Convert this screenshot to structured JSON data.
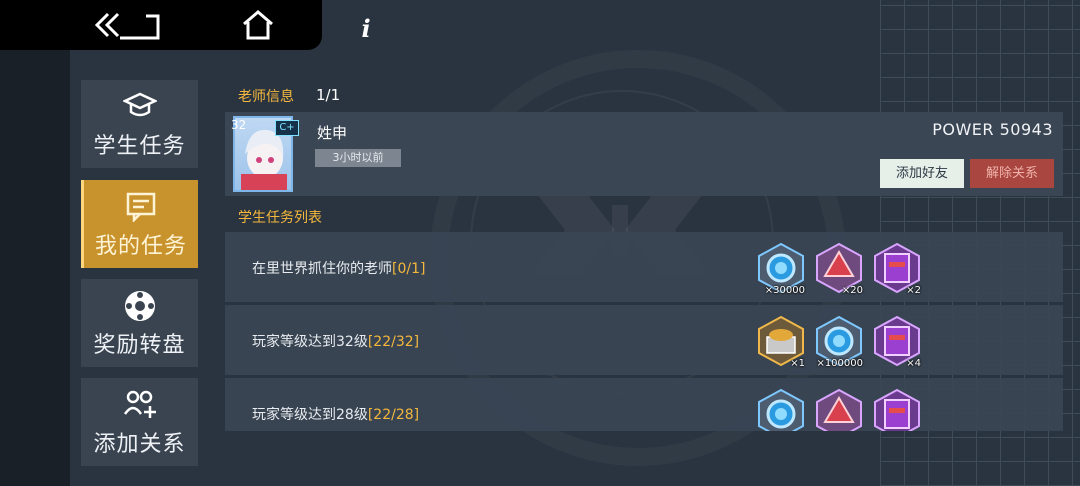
{
  "nav": {
    "back_icon": "double-chevron-left-icon",
    "home_icon": "home-icon",
    "info_label": "i"
  },
  "sidebar": {
    "items": [
      {
        "label": "学生任务",
        "icon": "graduation-cap-icon",
        "active": false
      },
      {
        "label": "我的任务",
        "icon": "task-board-icon",
        "active": true
      },
      {
        "label": "奖励转盘",
        "icon": "roulette-icon",
        "active": false
      },
      {
        "label": "添加关系",
        "icon": "add-relation-icon",
        "active": false
      }
    ]
  },
  "teacher_info": {
    "title": "老师信息",
    "count": "1/1",
    "level": "32",
    "rank": "C+",
    "name": "姓申",
    "last_seen": "3小时以前",
    "power": "POWER 50943",
    "add_friend_label": "添加好友",
    "remove_relation_label": "解除关系"
  },
  "task_list": {
    "title": "学生任务列表",
    "tasks": [
      {
        "text": "在里世界抓住你的老师",
        "progress": "[0/1]",
        "rewards": [
          {
            "icon": "blue-orb-icon",
            "qty": "×30000"
          },
          {
            "icon": "red-crystal-icon",
            "qty": "×20"
          },
          {
            "icon": "purple-book-icon",
            "qty": "×2"
          }
        ]
      },
      {
        "text": "玩家等级达到32级",
        "progress": "[22/32]",
        "rewards": [
          {
            "icon": "gold-chest-icon",
            "qty": "×1"
          },
          {
            "icon": "blue-orb-icon",
            "qty": "×100000"
          },
          {
            "icon": "purple-book-icon",
            "qty": "×4"
          }
        ]
      },
      {
        "text": "玩家等级达到28级",
        "progress": "[22/28]",
        "rewards": [
          {
            "icon": "blue-orb-icon",
            "qty": ""
          },
          {
            "icon": "red-crystal-icon",
            "qty": ""
          },
          {
            "icon": "purple-book-icon",
            "qty": ""
          }
        ]
      }
    ]
  },
  "colors": {
    "accent": "#f5b83d",
    "active_tab": "#c8932d",
    "danger": "#a8463f",
    "panel": "#3a4654"
  }
}
